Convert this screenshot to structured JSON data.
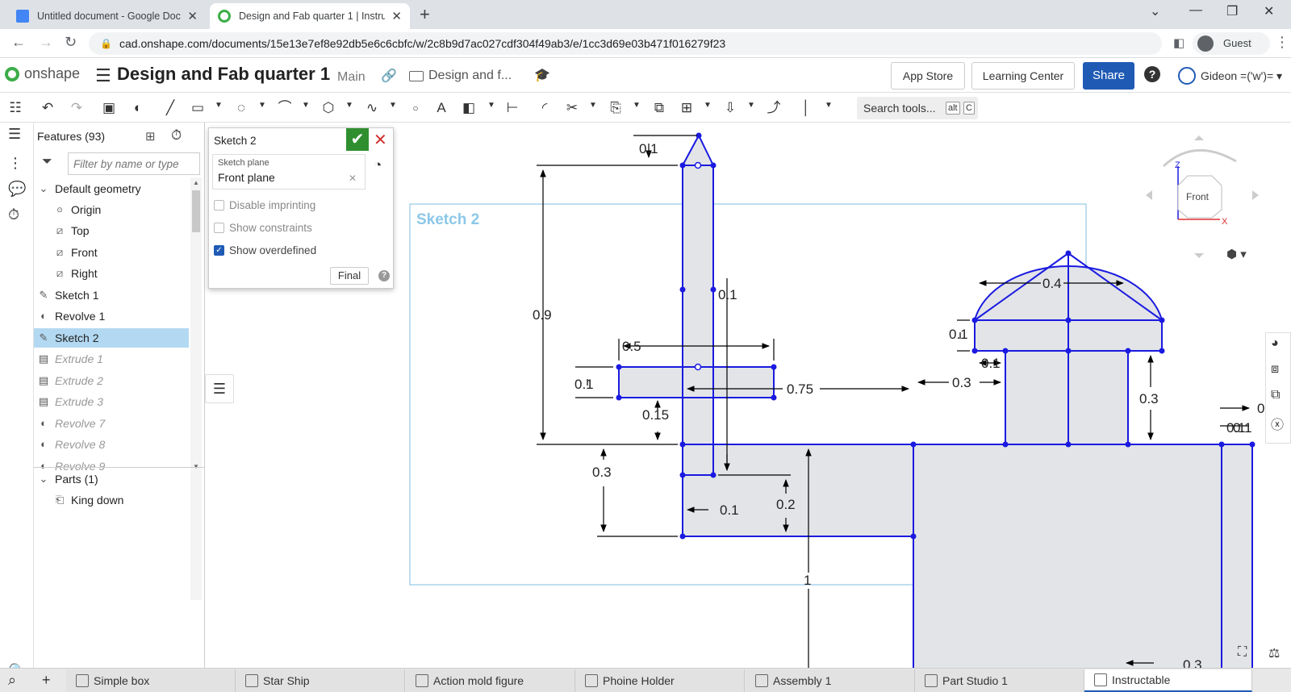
{
  "browser": {
    "tabs": [
      {
        "title": "Untitled document - Google Doc",
        "fav": "#4285f4"
      },
      {
        "title": "Design and Fab quarter 1 | Instru",
        "fav": "#3cad48"
      }
    ],
    "url": "cad.onshape.com/documents/15e13e7ef8e92db5e6c6cbfc/w/2c8b9d7ac027cdf304f49ab3/e/1cc3d69e03b471f016279f23",
    "profile": "Guest"
  },
  "app": {
    "logo": "onshape",
    "doc_title": "Design and Fab quarter 1",
    "branch": "Main",
    "folder": "Design and f...",
    "app_store": "App Store",
    "learning_center": "Learning Center",
    "share": "Share",
    "help": "?",
    "user": "Gideon =('w')= ▾"
  },
  "toolbar": {
    "search": "Search tools...",
    "key1": "alt",
    "key2": "C"
  },
  "features": {
    "header": "Features (93)",
    "filter_placeholder": "Filter by name or type",
    "default_geometry": "Default geometry",
    "items": [
      "Origin",
      "Top",
      "Front",
      "Right",
      "Sketch 1",
      "Revolve 1",
      "Sketch 2",
      "Extrude 1",
      "Extrude 2",
      "Extrude 3",
      "Revolve 7",
      "Revolve 8",
      "Revolve 9"
    ],
    "parts_header": "Parts (1)",
    "part": "King down"
  },
  "sketch_dialog": {
    "title": "Sketch 2",
    "plane_label": "Sketch plane",
    "plane_value": "Front plane",
    "opt_imprint": "Disable imprinting",
    "opt_constraints": "Show constraints",
    "opt_overdefined": "Show overdefined",
    "final": "Final"
  },
  "viewport": {
    "sketch_label": "Sketch 2",
    "dims": [
      "0.1",
      "0.9",
      "0.1",
      "0.5",
      "0.1",
      "0.75",
      "0.15",
      "0.3",
      "0.1",
      "0.2",
      "1",
      "0.4",
      "0.1",
      "0.1",
      "0.3",
      "0.3",
      "0.1",
      "0",
      "0.1",
      "0.3"
    ],
    "view_cube": {
      "face": "Front",
      "axis_z": "Z",
      "axis_x": "X"
    }
  },
  "bottom_tabs": [
    "Simple box",
    "Star Ship",
    "Action mold figure",
    "Phoine Holder",
    "Assembly 1",
    "Part Studio 1",
    "Instructable"
  ]
}
